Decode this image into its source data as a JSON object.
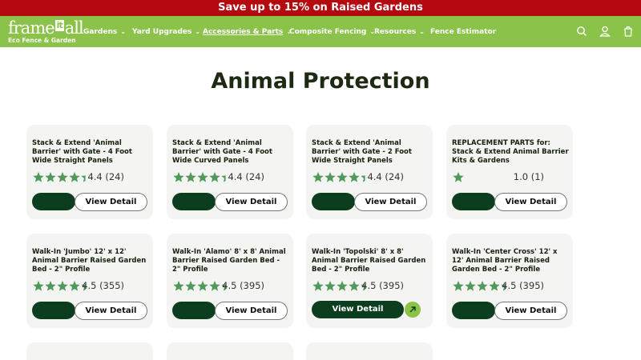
{
  "promo": {
    "text": "Save up to 15% on Raised Gardens"
  },
  "logo": {
    "word_left": "frame",
    "word_badge": "it",
    "word_right": "all",
    "tagline": "Eco Fence & Garden"
  },
  "nav": {
    "items": [
      {
        "label": "Gardens",
        "has_dropdown": true
      },
      {
        "label": "Yard Upgrades",
        "has_dropdown": true
      },
      {
        "label": "Accessories & Parts",
        "has_dropdown": true,
        "active": true
      },
      {
        "label": "Composite Fencing",
        "has_dropdown": true
      },
      {
        "label": "Resources",
        "has_dropdown": true
      },
      {
        "label": "Fence Estimator",
        "has_dropdown": false
      }
    ],
    "icons": [
      "search-icon",
      "account-icon",
      "cart-icon"
    ]
  },
  "page": {
    "title": "Animal Protection"
  },
  "colors": {
    "promo_bg": "#b3090f",
    "nav_bg": "#8bc34a",
    "star": "#4f9a5a",
    "button_dark": "#0b3d1f",
    "card_bg": "#f4f5f2"
  },
  "products": [
    {
      "title": "Stack & Extend 'Animal Barrier' with Gate - 4 Foot Wide Straight Panels",
      "rating": 4.4,
      "rating_text": "4.4 (24)",
      "button": "View Detail"
    },
    {
      "title": "Stack & Extend 'Animal Barrier' with Gate - 4 Foot Wide Curved Panels",
      "rating": 4.4,
      "rating_text": "4.4 (24)",
      "button": "View Detail"
    },
    {
      "title": "Stack & Extend 'Animal Barrier' with Gate - 2 Foot Wide Straight Panels",
      "rating": 4.4,
      "rating_text": "4.4 (24)",
      "button": "View Detail"
    },
    {
      "title": "REPLACEMENT PARTS for: Stack & Extend Animal Barrier Kits & Gardens",
      "rating": 1.0,
      "rating_text": "1.0 (1)",
      "button": "View Detail"
    },
    {
      "title": "Walk-In 'Jumbo' 12' x 12' Animal Barrier Raised Garden Bed - 2\" Profile",
      "rating": 4.5,
      "rating_text": "4.5 (355)",
      "button": "View Detail"
    },
    {
      "title": "Walk-In 'Alamo' 8' x 8' Animal Barrier Raised Garden Bed - 2\" Profile",
      "rating": 4.5,
      "rating_text": "4.5 (395)",
      "button": "View Detail"
    },
    {
      "title": "Walk-In 'Topolski' 8' x 8' Animal Barrier Raised Garden Bed - 2\" Profile",
      "rating": 4.5,
      "rating_text": "4.5 (395)",
      "button": "View Detail",
      "hover": true
    },
    {
      "title": "Walk-In 'Center Cross' 12' x 12' Animal Barrier Raised Garden Bed - 2\" Profile",
      "rating": 4.5,
      "rating_text": "4.5 (395)",
      "button": "View Detail"
    },
    {
      "title": "",
      "rating": null,
      "rating_text": "",
      "button": ""
    },
    {
      "title": "",
      "rating": null,
      "rating_text": "",
      "button": ""
    },
    {
      "title": "",
      "rating": null,
      "rating_text": "",
      "button": ""
    }
  ]
}
